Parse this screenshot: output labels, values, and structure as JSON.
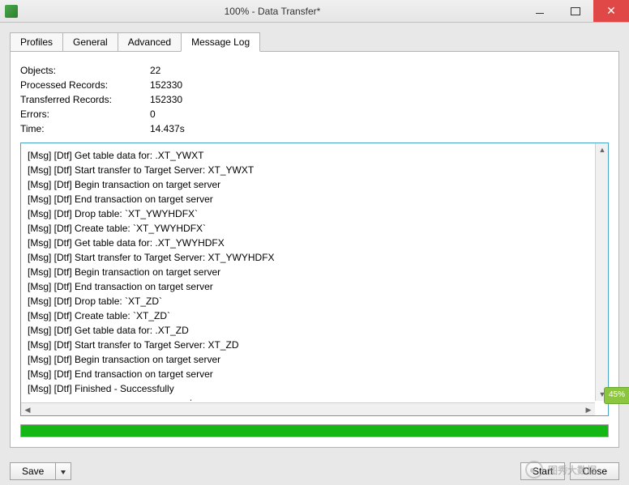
{
  "window": {
    "title": "100% - Data Transfer*"
  },
  "tabs": [
    {
      "key": "profiles",
      "label": "Profiles",
      "active": false
    },
    {
      "key": "general",
      "label": "General",
      "active": false
    },
    {
      "key": "advanced",
      "label": "Advanced",
      "active": false
    },
    {
      "key": "msglog",
      "label": "Message Log",
      "active": true
    }
  ],
  "stats": {
    "objects_label": "Objects:",
    "objects_value": "22",
    "processed_label": "Processed Records:",
    "processed_value": "152330",
    "transferred_label": "Transferred Records:",
    "transferred_value": "152330",
    "errors_label": "Errors:",
    "errors_value": "0",
    "time_label": "Time:",
    "time_value": "14.437s"
  },
  "log_lines": [
    "[Msg] [Dtf] Get table data for: .XT_YWXT",
    "[Msg] [Dtf] Start transfer to Target Server: XT_YWXT",
    "[Msg] [Dtf] Begin transaction on target server",
    "[Msg] [Dtf] End transaction on target server",
    "[Msg] [Dtf] Drop table: `XT_YWYHDFX`",
    "[Msg] [Dtf] Create table: `XT_YWYHDFX`",
    "[Msg] [Dtf] Get table data for: .XT_YWYHDFX",
    "[Msg] [Dtf] Start transfer to Target Server: XT_YWYHDFX",
    "[Msg] [Dtf] Begin transaction on target server",
    "[Msg] [Dtf] End transaction on target server",
    "[Msg] [Dtf] Drop table: `XT_ZD`",
    "[Msg] [Dtf] Create table: `XT_ZD`",
    "[Msg] [Dtf] Get table data for: .XT_ZD",
    "[Msg] [Dtf] Start transfer to Target Server: XT_ZD",
    "[Msg] [Dtf] Begin transaction on target server",
    "[Msg] [Dtf] End transaction on target server",
    "[Msg] [Dtf] Finished - Successfully",
    "--------------------------------------------------"
  ],
  "progress_percent": 100,
  "buttons": {
    "save": "Save",
    "start": "Start",
    "close": "Close"
  },
  "watermark_text": "图秀大数据",
  "side_tab_label": "45%"
}
